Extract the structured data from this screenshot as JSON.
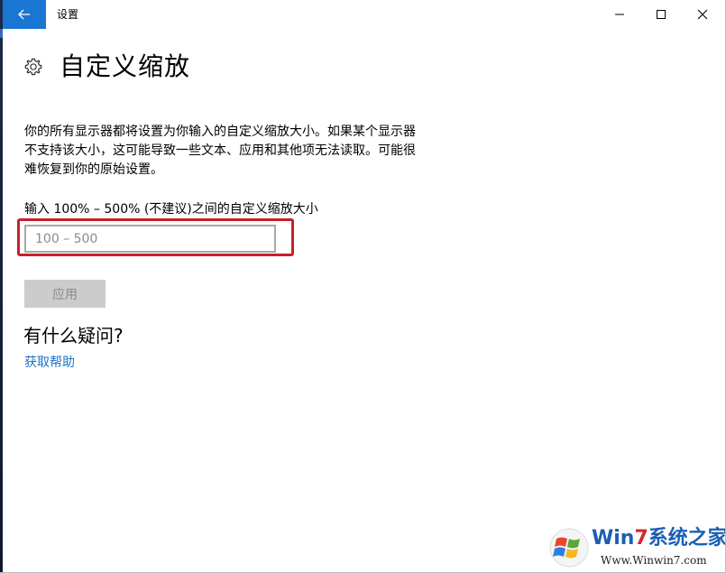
{
  "window": {
    "title": "设置",
    "accent_color": "#1976d2",
    "controls": [
      "minimize-icon",
      "maximize-icon",
      "close-icon"
    ]
  },
  "page": {
    "title": "自定义缩放",
    "icon": "gear-icon",
    "description": "你的所有显示器都将设置为你输入的自定义缩放大小。如果某个显示器不支持该大小，这可能导致一些文本、应用和其他项无法读取。可能很难恢复到你的原始设置。",
    "field_label": "输入 100% – 500% (不建议)之间的自定义缩放大小",
    "input": {
      "value": "",
      "placeholder": "100 – 500"
    },
    "highlight_color": "#c8202a",
    "apply_label": "应用",
    "apply_enabled": false,
    "faq_heading": "有什么疑问?",
    "help_link": "获取帮助",
    "link_color": "#1a73c8"
  },
  "watermark": {
    "brand_prefix": "Win",
    "brand_digit": "7",
    "brand_suffix": "系统之家",
    "url": "Www.Winwin7.com",
    "icon": "windows-logo-icon"
  }
}
